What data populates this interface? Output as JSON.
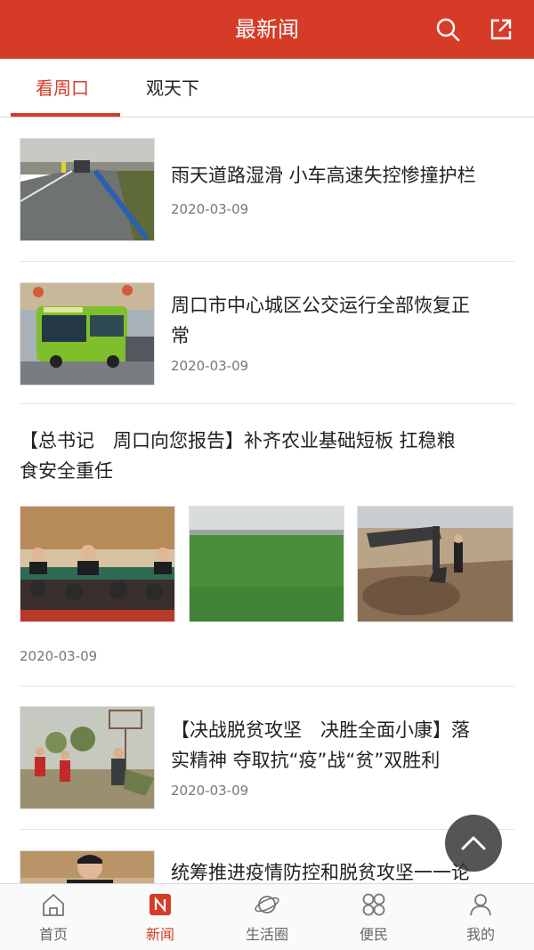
{
  "header": {
    "title": "最新闻"
  },
  "tabs": [
    {
      "label": "看周口"
    },
    {
      "label": "观天下"
    }
  ],
  "news": [
    {
      "title_lines": [
        "雨天道路湿滑 小车高速失控惨撞护栏"
      ],
      "date": "2020-03-09"
    },
    {
      "title_lines": [
        "周口市中心城区公交运行全部恢复正",
        "常"
      ],
      "date": "2020-03-09"
    },
    {
      "title_lines": [
        "【总书记　周口向您报告】补齐农业基础短板 扛稳粮",
        "食安全重任"
      ],
      "date": "2020-03-09"
    },
    {
      "title_lines": [
        "【决战脱贫攻坚　决胜全面小康】落",
        "实精神 夺取抗“疫”战“贫”双胜利"
      ],
      "date": "2020-03-09"
    },
    {
      "title_lines": [
        "统筹推进疫情防控和脱贫攻坚一一论"
      ],
      "date": ""
    }
  ],
  "bottom_nav": [
    {
      "label": "首页",
      "icon": "home-icon"
    },
    {
      "label": "新闻",
      "icon": "news-icon",
      "active": true
    },
    {
      "label": "生活圈",
      "icon": "planet-icon"
    },
    {
      "label": "便民",
      "icon": "grid-icon"
    },
    {
      "label": "我的",
      "icon": "user-icon"
    }
  ],
  "colors": {
    "accent": "#d63b28",
    "header_bg": "#d63b28",
    "nav_active": "#d63b28"
  }
}
